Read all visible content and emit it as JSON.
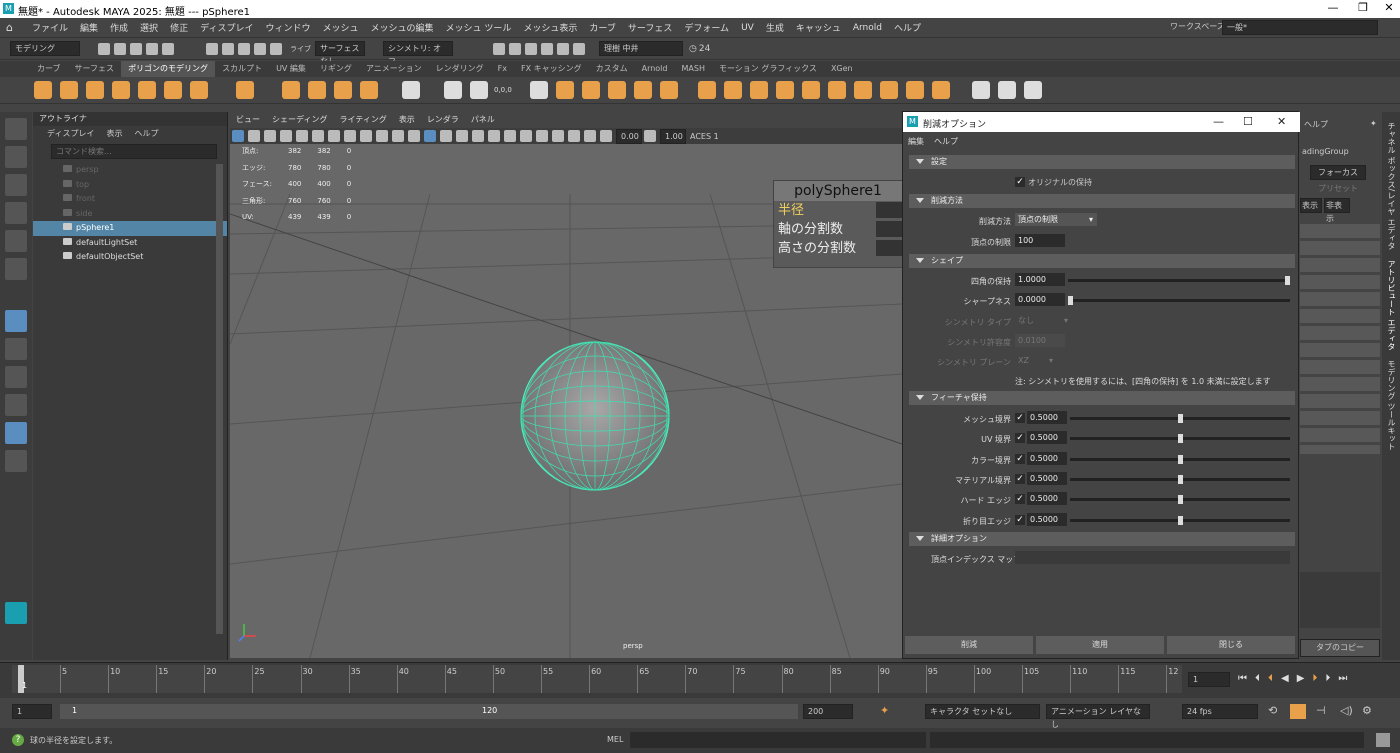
{
  "window": {
    "title": "無題* - Autodesk MAYA 2025: 無題  ---  pSphere1",
    "min": "—",
    "max": "❐",
    "close": "✕"
  },
  "menubar": {
    "items": [
      "ファイル",
      "編集",
      "作成",
      "選択",
      "修正",
      "ディスプレイ",
      "ウィンドウ",
      "メッシュ",
      "メッシュの編集",
      "メッシュ ツール",
      "メッシュ表示",
      "カーブ",
      "サーフェス",
      "デフォーム",
      "UV",
      "生成",
      "キャッシュ",
      "Arnold",
      "ヘルプ"
    ],
    "workspace_label": "ワークスペース:",
    "workspace_value": "一般*"
  },
  "statusline": {
    "mode": "モデリング",
    "live": "ライブ",
    "live_surface": "サーフェスなし",
    "symmetry": "シンメトリ: オフ",
    "user": "理樹 中井",
    "frame": "24"
  },
  "shelf": {
    "tabs": [
      "カーブ",
      "サーフェス",
      "ポリゴンのモデリング",
      "スカルプト",
      "UV 編集",
      "リギング",
      "アニメーション",
      "レンダリング",
      "Fx",
      "FX キャッシング",
      "カスタム",
      "Arnold",
      "MASH",
      "モーション グラフィックス",
      "XGen"
    ],
    "active": "ポリゴンのモデリング",
    "coord": "0,0,0"
  },
  "outliner": {
    "title": "アウトライナ",
    "menu": [
      "ディスプレイ",
      "表示",
      "ヘルプ"
    ],
    "search_placeholder": "コマンド検索...",
    "items": [
      {
        "label": "persp",
        "dim": true
      },
      {
        "label": "top",
        "dim": true
      },
      {
        "label": "front",
        "dim": true
      },
      {
        "label": "side",
        "dim": true
      },
      {
        "label": "pSphere1",
        "selected": true
      },
      {
        "label": "defaultLightSet"
      },
      {
        "label": "defaultObjectSet"
      }
    ]
  },
  "viewport": {
    "menu": [
      "ビュー",
      "シェーディング",
      "ライティング",
      "表示",
      "レンダラ",
      "パネル"
    ],
    "exposure": "0.00",
    "gamma": "1.00",
    "colorspace": "ACES 1",
    "camera": "persp",
    "hud": [
      [
        "頂点:",
        "382",
        "382",
        "0"
      ],
      [
        "エッジ:",
        "780",
        "780",
        "0"
      ],
      [
        "フェース:",
        "400",
        "400",
        "0"
      ],
      [
        "三角形:",
        "760",
        "760",
        "0"
      ],
      [
        "UV:",
        "439",
        "439",
        "0"
      ]
    ],
    "channelbox": {
      "title": "polySphere1",
      "attrs": [
        "半径",
        "軸の分割数",
        "高さの分割数"
      ]
    }
  },
  "dialog": {
    "title": "削減オプション",
    "menu": [
      "編集",
      "ヘルプ"
    ],
    "sections": {
      "settings": "設定",
      "reduce_method": "削減方法",
      "shape": "シェイプ",
      "feature": "フィーチャ保持",
      "advanced": "詳細オプション"
    },
    "keep_original": "オリジナルの保持",
    "method_label": "削減方法",
    "method_value": "頂点の制限",
    "vertex_limit_label": "頂点の制限",
    "vertex_limit_value": "100",
    "keep_quads_label": "四角の保持",
    "keep_quads_value": "1.0000",
    "keep_quads_level": 1.0,
    "sharpness_label": "シャープネス",
    "sharpness_value": "0.0000",
    "sharpness_level": 0.0,
    "sym_type_label": "シンメトリ タイプ",
    "sym_type_value": "なし",
    "sym_tol_label": "シンメトリ許容度",
    "sym_tol_value": "0.0100",
    "sym_plane_label": "シンメトリ プレーン",
    "sym_plane_value": "XZ",
    "note": "注: シンメトリを使用するには、[四角の保持] を 1.0 未満に設定します",
    "features": [
      {
        "label": "メッシュ境界",
        "value": "0.5000",
        "level": 0.5
      },
      {
        "label": "UV 境界",
        "value": "0.5000",
        "level": 0.5
      },
      {
        "label": "カラー境界",
        "value": "0.5000",
        "level": 0.5
      },
      {
        "label": "マテリアル境界",
        "value": "0.5000",
        "level": 0.5
      },
      {
        "label": "ハード エッジ",
        "value": "0.5000",
        "level": 0.5
      },
      {
        "label": "折り目エッジ",
        "value": "0.5000",
        "level": 0.5
      }
    ],
    "vertex_index_map_label": "頂点インデックス マップ",
    "buttons": {
      "reduce": "削減",
      "apply": "適用",
      "close": "閉じる"
    }
  },
  "rightpanel": {
    "help": "ヘルプ",
    "shading_group": "adingGroup",
    "focus": "フォーカス",
    "preset": "プリセット",
    "show": "表示",
    "hide": "非表示",
    "copy_tab": "タブのコピー",
    "vtabs": [
      "チャネル ボックス/レイヤ エディタ",
      "アトリビュート エディタ",
      "モデリング ツールキット"
    ]
  },
  "time": {
    "ticks": [
      "5",
      "10",
      "15",
      "20",
      "25",
      "30",
      "35",
      "40",
      "45",
      "50",
      "55",
      "60",
      "65",
      "70",
      "75",
      "80",
      "85",
      "90",
      "95",
      "100",
      "105",
      "110",
      "115",
      "12"
    ],
    "current": "1",
    "start": "1",
    "range_start": "1",
    "range_end": "120",
    "end": "200",
    "character_set": "キャラクタ セットなし",
    "anim_layer": "アニメーション レイヤなし",
    "fps": "24 fps",
    "frame_field": "1"
  },
  "cmdline": {
    "help": "球の半径を設定します。",
    "lang": "MEL"
  }
}
